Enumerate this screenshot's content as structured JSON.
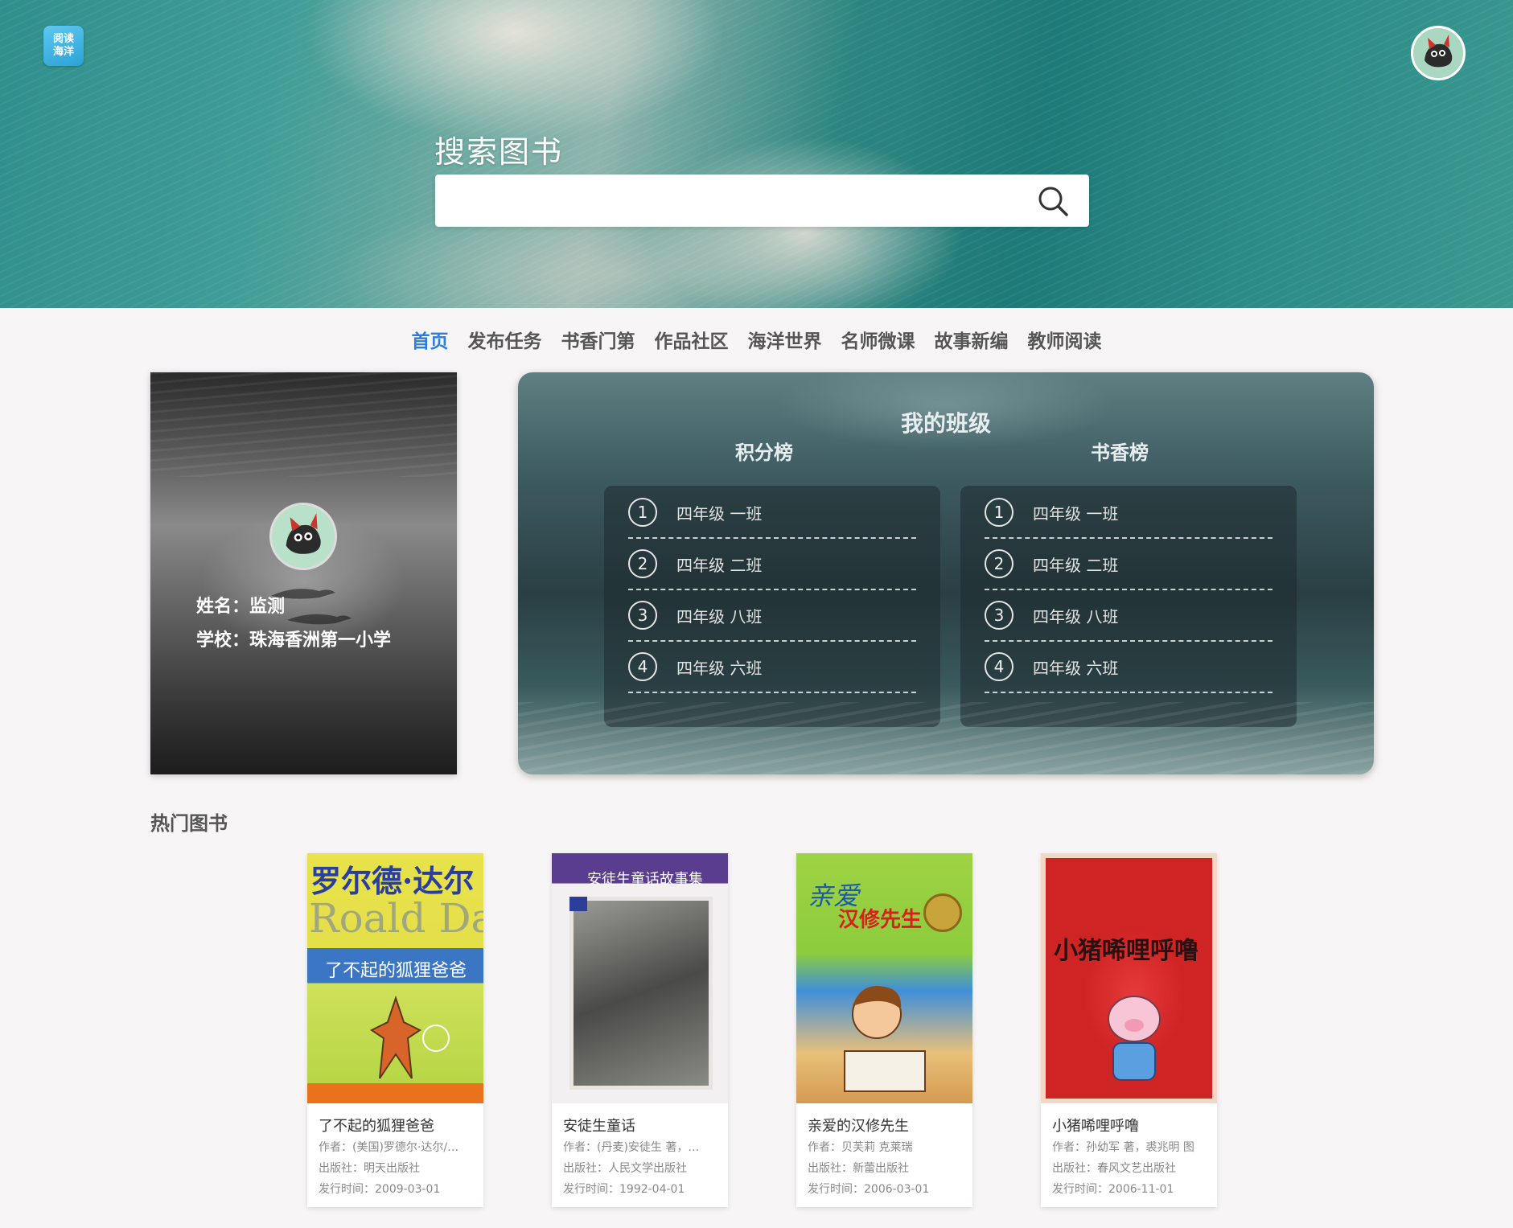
{
  "header": {
    "logo_line1": "阅读",
    "logo_line2": "海洋",
    "search_title": "搜索图书",
    "search_value": ""
  },
  "nav": {
    "items": [
      {
        "label": "首页",
        "active": true
      },
      {
        "label": "发布任务"
      },
      {
        "label": "书香门第"
      },
      {
        "label": "作品社区"
      },
      {
        "label": "海洋世界"
      },
      {
        "label": "名师微课"
      },
      {
        "label": "故事新编"
      },
      {
        "label": "教师阅读"
      }
    ]
  },
  "profile": {
    "name_line": "姓名：监测",
    "school_line": "学校：珠海香洲第一小学"
  },
  "class_board": {
    "title": "我的班级",
    "points": {
      "heading": "积分榜",
      "rows": [
        {
          "rank": "1",
          "name": "四年级 一班"
        },
        {
          "rank": "2",
          "name": "四年级 二班"
        },
        {
          "rank": "3",
          "name": "四年级 八班"
        },
        {
          "rank": "4",
          "name": "四年级 六班"
        }
      ]
    },
    "books": {
      "heading": "书香榜",
      "rows": [
        {
          "rank": "1",
          "name": "四年级 一班"
        },
        {
          "rank": "2",
          "name": "四年级 二班"
        },
        {
          "rank": "3",
          "name": "四年级 八班"
        },
        {
          "rank": "4",
          "name": "四年级 六班"
        }
      ]
    }
  },
  "hot_books": {
    "title": "热门图书",
    "items": [
      {
        "cover_text_1": "罗尔德·达尔",
        "cover_text_2": "Roald Dahl",
        "cover_text_3": "了不起的狐狸爸爸",
        "name": "了不起的狐狸爸爸",
        "author": "作者：(美国)罗德尔·达尔/…",
        "publisher": "出版社：明天出版社",
        "date": "发行时间：2009-03-01"
      },
      {
        "cover_text_1": "安徒生童话故事集",
        "name": "安徒生童话",
        "author": "作者：(丹麦)安徒生 著，…",
        "publisher": "出版社：人民文学出版社",
        "date": "发行时间：1992-04-01"
      },
      {
        "cover_text_1": "亲爱",
        "cover_text_2": "汉修先生",
        "name": "亲爱的汉修先生",
        "author": "作者：贝芙莉 克莱瑞",
        "publisher": "出版社：新蕾出版社",
        "date": "发行时间：2006-03-01"
      },
      {
        "cover_text_1": "小猪唏哩呼噜",
        "name": "小猪唏哩呼噜",
        "author": "作者：孙幼军 著，裘兆明 图",
        "publisher": "出版社：春风文艺出版社",
        "date": "发行时间：2006-11-01"
      }
    ]
  }
}
